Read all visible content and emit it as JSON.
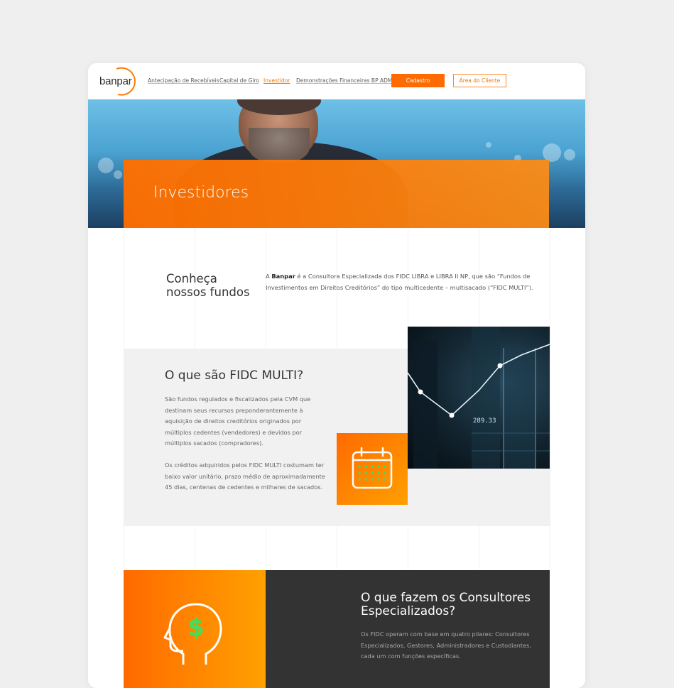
{
  "brand": {
    "logo_text": "banpar",
    "accent": "#ff6b00",
    "dark": "#333333"
  },
  "nav": {
    "links": [
      "Antecipação de Recebíveis",
      "Capital de Giro",
      "Investidor",
      "Demonstrações Financeiras BP ADM"
    ],
    "active_index": 2,
    "cadastro": "Cadastro",
    "area_cliente": "Área do Cliente"
  },
  "hero": {
    "title": "Investidores"
  },
  "funds": {
    "title_line1": "Conheça",
    "title_line2": "nossos fundos",
    "text_pre": "A ",
    "text_bold": "Banpar",
    "text_post": " é a Consultora Especializada dos FIDC LIBRA e LIBRA II NP, que são “Fundos de Investimentos em Direitos Creditórios” do tipo multicedente – multisacado (“FIDC MULTI”)."
  },
  "fidc": {
    "title": "O que são FIDC MULTI?",
    "p1": "São fundos regulados e fiscalizados pela CVM que destinam seus recursos preponderantemente à aquisição de direitos creditórios originados por múltiplos cedentes (vendedores) e devidos por múltiplos sacados (compradores).",
    "p2": "Os créditos adquiridos pelos FIDC MULTI costumam ter baixo valor unitário, prazo médio de aproximadamente 45 dias, centenas de cedentes e milhares de sacados.",
    "chart_label": "289.33",
    "calendar_icon": "calendar-icon"
  },
  "consultores": {
    "title": "O que fazem os Consultores Especializados?",
    "p1": "Os FIDC operam com base em quatro pilares: Consultores Especializados, Gestores, Administradores e Custodiantes, cada um com funções específicas.",
    "head_icon": "head-dollar-icon"
  }
}
